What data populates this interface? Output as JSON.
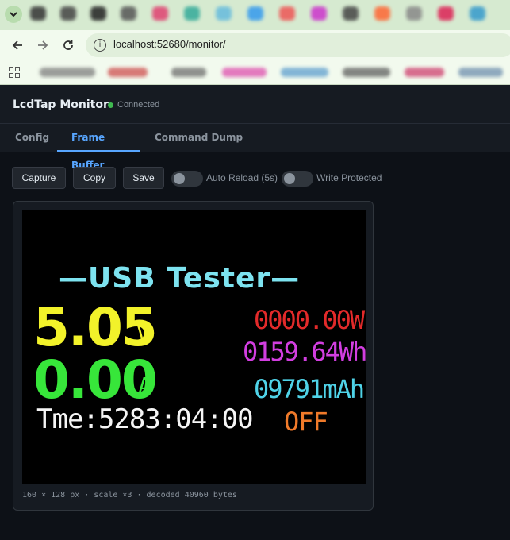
{
  "browser": {
    "url": "localhost:52680/monitor/"
  },
  "app": {
    "title": "LcdTap Monitor",
    "status": "Connected",
    "status_color": "#3fb950",
    "accent_color": "#58a6ff"
  },
  "tabs": [
    {
      "label": "Config"
    },
    {
      "label": "Frame Buffer",
      "active": true
    },
    {
      "label": "Command Dump"
    }
  ],
  "toolbar": {
    "capture_label": "Capture",
    "copy_label": "Copy",
    "save_label": "Save",
    "auto_reload_label": "Auto Reload (5s)",
    "auto_reload_on": false,
    "write_protected_label": "Write Protected",
    "write_protected_on": false
  },
  "lcd": {
    "title": "—USB Tester—",
    "voltage": "5.05",
    "voltage_unit": "V",
    "current": "0.00",
    "current_unit": "A",
    "time": "Tme:5283:04:00",
    "power": "0000.00W",
    "energy": "0159.64Wh",
    "capacity": "09791mAh",
    "state": "OFF"
  },
  "caption": "160 × 128 px · scale ×3 · decoded 40960 bytes"
}
